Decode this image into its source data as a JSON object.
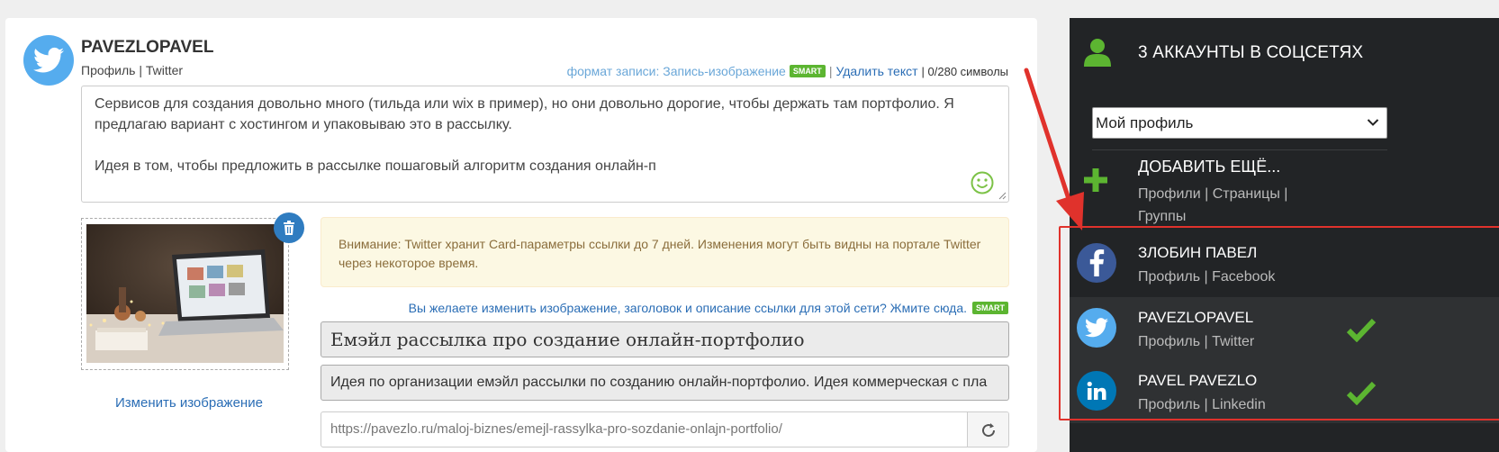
{
  "post": {
    "account_name": "PAVEZLOPAVEL",
    "account_sub": "Профиль | Twitter",
    "format_label": "формат записи: Запись-изображение",
    "smart_badge": "SMART",
    "separator": "|",
    "delete_text": "Удалить текст",
    "char_count": "| 0/280 символы",
    "text_lines": [
      "Сервисов для создания довольно много (тильда или wix в пример), но они довольно дорогие, чтобы держать там портфолио. Я",
      "предлагаю вариант с хостингом и упаковываю это в рассылку.",
      "",
      "Идея в том, чтобы предложить в рассылке пошаговый алгоритм создания онлайн-п"
    ],
    "change_image": "Изменить изображение",
    "alert": "Внимание: Twitter хранит Card-параметры ссылки до 7 дней. Изменения могут быть видны на портале Twitter через некоторое время.",
    "change_link": "Вы желаете изменить изображение, заголовок и описание ссылки для этой сети? Жмите сюда.",
    "link_title": "Емэйл рассылка про создание онлайн-портфолио",
    "link_desc": "Идея по организации емэйл рассылки по созданию онлайн-портфолио. Идея коммерческая с пла",
    "link_url": "https://pavezlo.ru/maloj-biznes/emejl-rassylka-pro-sozdanie-onlajn-portfolio/"
  },
  "sidebar": {
    "title": "3 АККАУНТЫ В СОЦСЕТЯХ",
    "select_value": "Мой профиль",
    "add_title": "ДОБАВИТЬ ЕЩЁ...",
    "add_links": "Профили | Страницы | Группы",
    "accounts": [
      {
        "name": "ЗЛОБИН ПАВЕЛ",
        "sub": "Профиль | Facebook",
        "icon": "facebook-icon",
        "color": "#3b5998",
        "checked": false
      },
      {
        "name": "PAVEZLOPAVEL",
        "sub": "Профиль | Twitter",
        "icon": "twitter-icon",
        "color": "#55acee",
        "checked": true
      },
      {
        "name": "PAVEL PAVEZLO",
        "sub": "Профиль | Linkedin",
        "icon": "linkedin-icon",
        "color": "#0077b5",
        "checked": true
      }
    ]
  },
  "colors": {
    "accent_green": "#5cb531",
    "link_blue": "#2a6db5",
    "annotation_red": "#e0322c"
  }
}
